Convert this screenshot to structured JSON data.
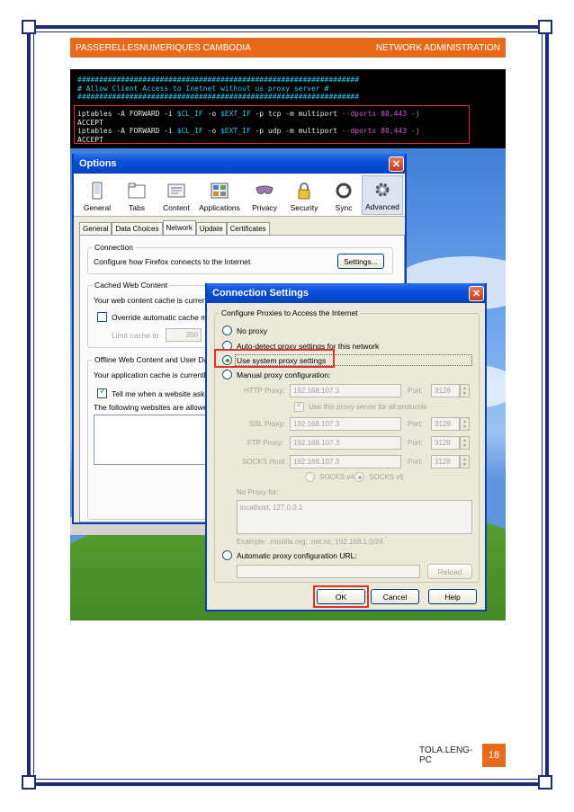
{
  "header": {
    "left": "PASSERELLESNUMERIQUES CAMBODIA",
    "right": "NETWORK ADMINISTRATION"
  },
  "footer": {
    "author": "TOLA.LENG-PC",
    "page": "18"
  },
  "terminal": {
    "hash1": "#################################################################",
    "comment": "# Allow Client Access to Inetnet without us proxy server #",
    "hash2": "#################################################################",
    "l1_a": "iptables -A FORWARD -i ",
    "l1_v1": "$CL_IF",
    "l1_b": " -o ",
    "l1_v2": "$EXT_IF",
    "l1_c": " -p tcp -m multiport ",
    "l1_d": "--dports 80,443 -j",
    "l2": "ACCEPT",
    "l3_a": "iptables -A FORWARD -i ",
    "l3_v1": "$CL_IF",
    "l3_b": " -o ",
    "l3_v2": "$EXT_IF",
    "l3_c": " -p udp -m multiport ",
    "l3_d": "--dports 80,443 -j",
    "l4": "ACCEPT"
  },
  "options": {
    "title": "Options",
    "close": "✕",
    "toolbar": [
      "General",
      "Tabs",
      "Content",
      "Applications",
      "Privacy",
      "Security",
      "Sync",
      "Advanced"
    ],
    "tabs": [
      "General",
      "Data Choices",
      "Network",
      "Update",
      "Certificates"
    ],
    "connection": {
      "label": "Connection",
      "text": "Configure how Firefox connects to the Internet",
      "button": "Settings..."
    },
    "cache": {
      "label": "Cached Web Content",
      "text": "Your web content cache is current",
      "override": "Override automatic cache ma",
      "limit_label": "Limit cache to",
      "limit_value": "350"
    },
    "offline": {
      "label": "Offline Web Content and User Dat",
      "text": "Your application cache is currently",
      "tell": "Tell me when a website asks to",
      "allowed": "The following websites are allowed"
    }
  },
  "connection_settings": {
    "title": "Connection Settings",
    "close": "✕",
    "group_label": "Configure Proxies to Access the Internet",
    "no_proxy": "No proxy",
    "auto_detect": "Auto-detect proxy settings for this network",
    "use_system": "Use system proxy settings",
    "manual": "Manual proxy configuration:",
    "http_label": "HTTP Proxy:",
    "http_value": "192.168.107.3",
    "port_label": "Port:",
    "http_port": "3128",
    "same_proxy": "Use this proxy server for all protocols",
    "ssl_label": "SSL Proxy:",
    "ssl_value": "192.168.107.3",
    "ssl_port": "3128",
    "ftp_label": "FTP Proxy:",
    "ftp_value": "192.168.107.3",
    "ftp_port": "3128",
    "socks_label": "SOCKS Host:",
    "socks_value": "192.168.107.3",
    "socks_port": "3128",
    "socks4": "SOCKS v4",
    "socks5": "SOCKS v5",
    "noproxy_label": "No Proxy for:",
    "noproxy_value": "localhost, 127.0.0.1",
    "example": "Example: .mozilla.org, .net.nz, 192.168.1.0/24",
    "auto_url": "Automatic proxy configuration URL:",
    "reload": "Reload",
    "ok": "OK",
    "cancel": "Cancel",
    "help": "Help"
  },
  "colors": {
    "accent_orange": "#e86a1c",
    "border_navy": "#1c2b78",
    "highlight_red": "#e23030"
  }
}
